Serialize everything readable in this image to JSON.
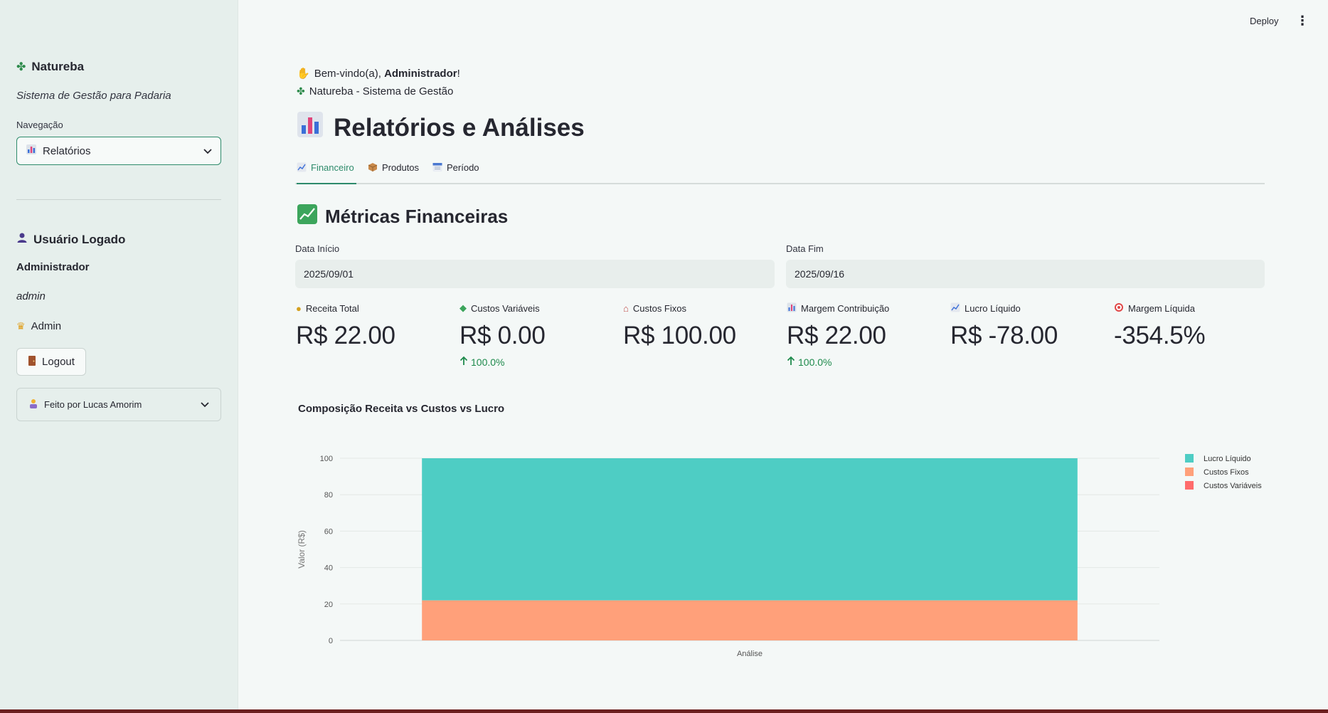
{
  "topbar": {
    "deploy_label": "Deploy",
    "menu_icon": "vertical-dots-icon"
  },
  "sidebar": {
    "brand": "Natureba",
    "subtitle": "Sistema de Gestão para Padaria",
    "nav_label": "Navegação",
    "nav_selected": "Relatórios",
    "user_section_title": "Usuário Logado",
    "user_name": "Administrador",
    "user_login": "admin",
    "user_role": "Admin",
    "logout_label": "Logout",
    "expander_label": "Feito por Lucas Amorim"
  },
  "main": {
    "welcome_prefix": "Bem-vindo(a), ",
    "welcome_name": "Administrador",
    "welcome_suffix": "!",
    "system_name": "Natureba - Sistema de Gestão",
    "page_title": "Relatórios e Análises",
    "tabs": [
      {
        "label": "Financeiro",
        "active": true
      },
      {
        "label": "Produtos",
        "active": false
      },
      {
        "label": "Período",
        "active": false
      }
    ],
    "section_title": "Métricas Financeiras",
    "date_start_label": "Data Início",
    "date_start_value": "2025/09/01",
    "date_end_label": "Data Fim",
    "date_end_value": "2025/09/16",
    "metrics": [
      {
        "label": "Receita Total",
        "value": "R$ 22.00",
        "delta": ""
      },
      {
        "label": "Custos Variáveis",
        "value": "R$ 0.00",
        "delta": "100.0%"
      },
      {
        "label": "Custos Fixos",
        "value": "R$ 100.00",
        "delta": ""
      },
      {
        "label": "Margem Contribuição",
        "value": "R$ 22.00",
        "delta": "100.0%"
      },
      {
        "label": "Lucro Líquido",
        "value": "R$ -78.00",
        "delta": ""
      },
      {
        "label": "Margem Líquida",
        "value": "-354.5%",
        "delta": ""
      }
    ],
    "chart_title": "Composição Receita vs Custos vs Lucro"
  },
  "colors": {
    "accent": "#2e8b6b",
    "lucro": "#4ecdc4",
    "fixos": "#ffa07a",
    "variaveis": "#ff6b6b"
  },
  "chart_data": {
    "type": "bar",
    "stacked": true,
    "categories": [
      "Análise"
    ],
    "series": [
      {
        "name": "Custos Variáveis",
        "values": [
          0
        ],
        "color": "#ff6b6b"
      },
      {
        "name": "Custos Fixos",
        "values": [
          22
        ],
        "color": "#ffa07a"
      },
      {
        "name": "Lucro Líquido",
        "values": [
          78
        ],
        "color": "#4ecdc4"
      }
    ],
    "legend_order": [
      "Lucro Líquido",
      "Custos Fixos",
      "Custos Variáveis"
    ],
    "xlabel": "Análise",
    "ylabel": "Valor (R$)",
    "ylim": [
      0,
      100
    ],
    "yticks": [
      0,
      20,
      40,
      60,
      80,
      100
    ],
    "grid": true,
    "legend_position": "right"
  }
}
